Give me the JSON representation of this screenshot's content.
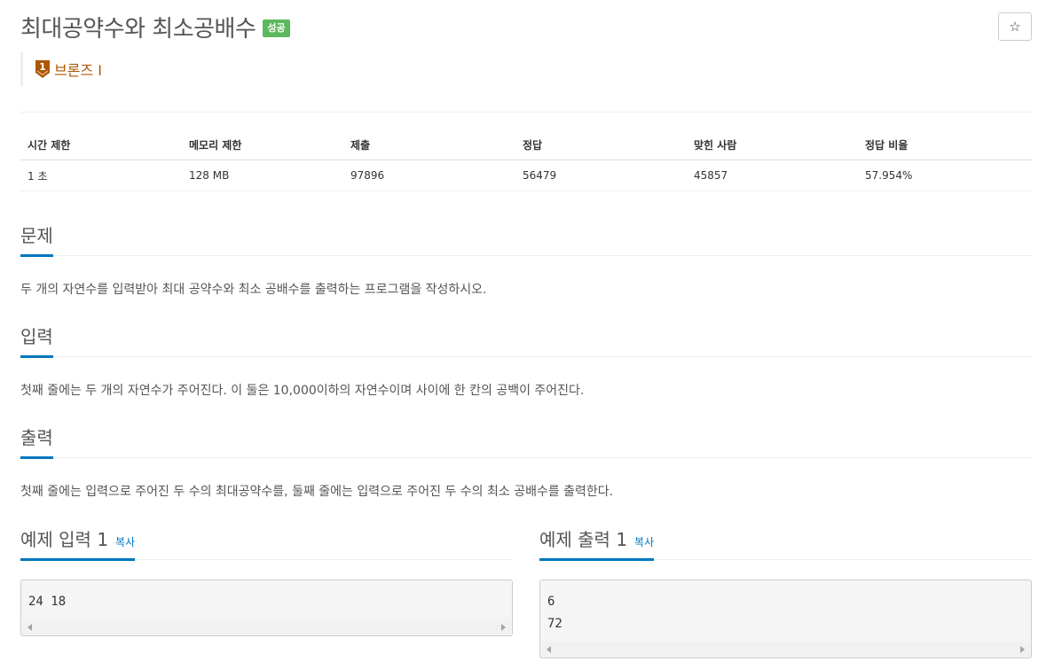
{
  "problem": {
    "title": "최대공약수와 최소공배수",
    "status_badge": "성공",
    "star_icon": "☆",
    "tier": {
      "label": "브론즈 I",
      "number": "1",
      "color": "#ad5600"
    }
  },
  "info_table": {
    "headers": [
      "시간 제한",
      "메모리 제한",
      "제출",
      "정답",
      "맞힌 사람",
      "정답 비율"
    ],
    "values": [
      "1 초",
      "128 MB",
      "97896",
      "56479",
      "45857",
      "57.954%"
    ]
  },
  "sections": {
    "description": {
      "heading": "문제",
      "text": "두 개의 자연수를 입력받아 최대 공약수와 최소 공배수를 출력하는 프로그램을 작성하시오."
    },
    "input": {
      "heading": "입력",
      "text": "첫째 줄에는 두 개의 자연수가 주어진다. 이 둘은 10,000이하의 자연수이며 사이에 한 칸의 공백이 주어진다."
    },
    "output": {
      "heading": "출력",
      "text": "첫째 줄에는 입력으로 주어진 두 수의 최대공약수를, 둘째 줄에는 입력으로 주어진 두 수의 최소 공배수를 출력한다."
    }
  },
  "samples": {
    "input": {
      "heading": "예제 입력 1",
      "copy_label": "복사",
      "content": "24 18"
    },
    "output": {
      "heading": "예제 출력 1",
      "copy_label": "복사",
      "content": "6\n72"
    }
  },
  "colors": {
    "accent": "#0076c0",
    "success": "#5cb85c",
    "bronze": "#ad5600"
  }
}
